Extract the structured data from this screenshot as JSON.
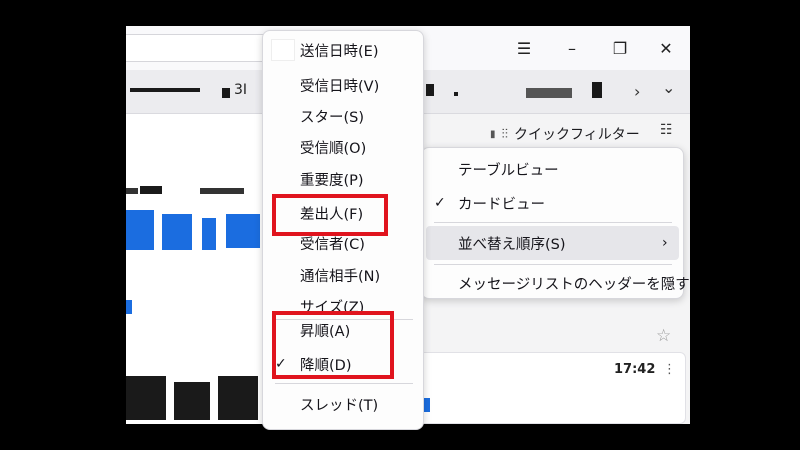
{
  "window_controls": {
    "menu_icon": "hamburger-icon",
    "minimize_icon": "minimize-icon",
    "restore_icon": "restore-icon",
    "close_icon": "close-icon"
  },
  "tabbar": {
    "visible_fragment": "3I",
    "scroll_right": "›",
    "list_all": "⌄"
  },
  "toolbar": {
    "quick_filter_label": "クイックフィルター"
  },
  "card": {
    "time": "17:42"
  },
  "sort_menu": {
    "items": [
      {
        "label": "送信日時(E)",
        "checked": false
      },
      {
        "label": "受信日時(V)",
        "checked": false
      },
      {
        "label": "スター(S)",
        "checked": false
      },
      {
        "label": "受信順(O)",
        "checked": false
      },
      {
        "label": "重要度(P)",
        "checked": false
      },
      {
        "label": "差出人(F)",
        "checked": false
      },
      {
        "label": "受信者(C)",
        "checked": false
      },
      {
        "label": "通信相手(N)",
        "checked": false
      },
      {
        "label": "サイズ(Z)",
        "checked": false
      }
    ],
    "order_items": [
      {
        "label": "昇順(A)",
        "checked": false
      },
      {
        "label": "降順(D)",
        "checked": true
      }
    ],
    "thread_items": [
      {
        "label": "スレッド(T)",
        "checked": false
      }
    ]
  },
  "view_menu": {
    "items": [
      {
        "label": "テーブルビュー",
        "checked": false
      },
      {
        "label": "カードビュー",
        "checked": true
      },
      {
        "label": "並べ替え順序(S)",
        "submenu": true,
        "highlighted": true
      },
      {
        "label": "メッセージリストのヘッダーを隠す",
        "checked": false
      }
    ]
  },
  "highlight_color": "#e0141e",
  "accent_color": "#1b6de0"
}
